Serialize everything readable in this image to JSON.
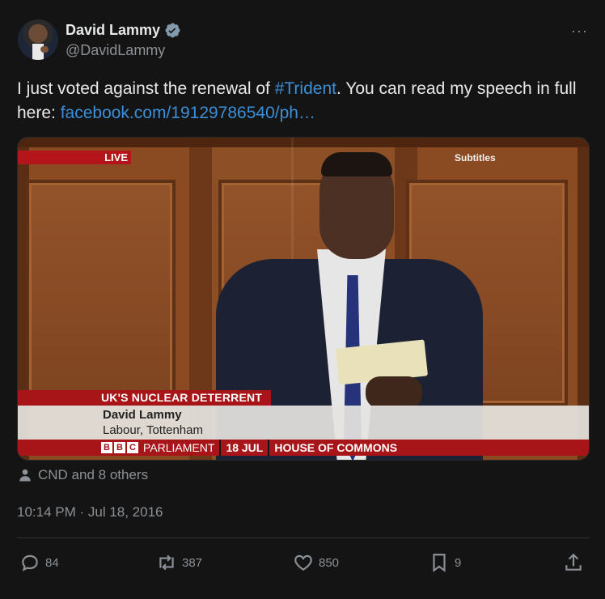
{
  "author": {
    "name": "David Lammy",
    "handle": "@DavidLammy",
    "verified_icon": "verified-badge-icon",
    "more_label": "···"
  },
  "tweet": {
    "text_before": "I just voted against the renewal of ",
    "hashtag": "#Trident",
    "text_middle": ". You can read my speech in full here: ",
    "link": "facebook.com/19129786540/ph…"
  },
  "media": {
    "live_label": "LIVE",
    "subtitles_label": "Subtitles",
    "topic": "UK'S NUCLEAR DETERRENT",
    "speaker_name": "David Lammy",
    "speaker_role": "Labour, Tottenham",
    "bbc_letters": [
      "B",
      "B",
      "C"
    ],
    "channel": "PARLIAMENT",
    "date": "18 JUL",
    "venue": "HOUSE OF COMMONS"
  },
  "likes_summary": "CND and 8 others",
  "timestamp": "10:14 PM · Jul 18, 2016",
  "actions": {
    "replies": "84",
    "retweets": "387",
    "likes": "850",
    "bookmarks": "9"
  },
  "colors": {
    "background": "#141414",
    "link": "#3b8fd8",
    "muted": "#8b9196",
    "bbc_red": "#a81519"
  }
}
